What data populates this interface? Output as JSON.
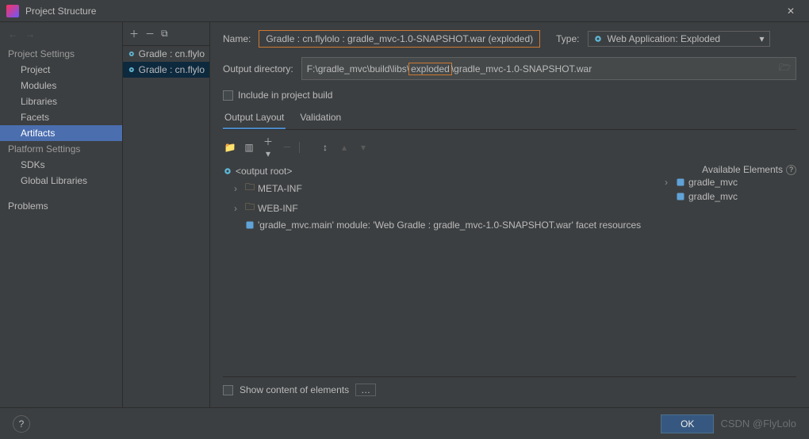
{
  "window": {
    "title": "Project Structure",
    "close_icon": "close"
  },
  "sidebar": {
    "groups": [
      {
        "title": "Project Settings",
        "items": [
          "Project",
          "Modules",
          "Libraries",
          "Facets",
          "Artifacts"
        ],
        "selected": "Artifacts"
      },
      {
        "title": "Platform Settings",
        "items": [
          "SDKs",
          "Global Libraries"
        ]
      },
      {
        "title": "",
        "items": [
          "Problems"
        ]
      }
    ]
  },
  "artifact_list": {
    "items": [
      {
        "label": "Gradle : cn.flylo"
      },
      {
        "label": "Gradle : cn.flylo"
      }
    ],
    "selected_index": 1
  },
  "form": {
    "name_label": "Name:",
    "name_value": "Gradle : cn.flylolo : gradle_mvc-1.0-SNAPSHOT.war (exploded)",
    "type_label": "Type:",
    "type_value": "Web Application: Exploded",
    "od_label": "Output directory:",
    "od_pre": "F:\\gradle_mvc\\build\\libs\\",
    "od_hl": "exploded",
    "od_post": "\\gradle_mvc-1.0-SNAPSHOT.war",
    "include_label": "Include in project build"
  },
  "tabs": {
    "items": [
      "Output Layout",
      "Validation"
    ],
    "active": 0
  },
  "tree": {
    "root": "<output root>",
    "nodes": [
      {
        "label": "META-INF"
      },
      {
        "label": "WEB-INF"
      }
    ],
    "leaf": "'gradle_mvc.main' module: 'Web Gradle : gradle_mvc-1.0-SNAPSHOT.war' facet resources"
  },
  "available": {
    "title": "Available Elements",
    "items": [
      "gradle_mvc",
      "gradle_mvc"
    ]
  },
  "bottom": {
    "show_content": "Show content of elements"
  },
  "footer": {
    "ok": "OK",
    "watermark": "CSDN @FlyLolo"
  }
}
